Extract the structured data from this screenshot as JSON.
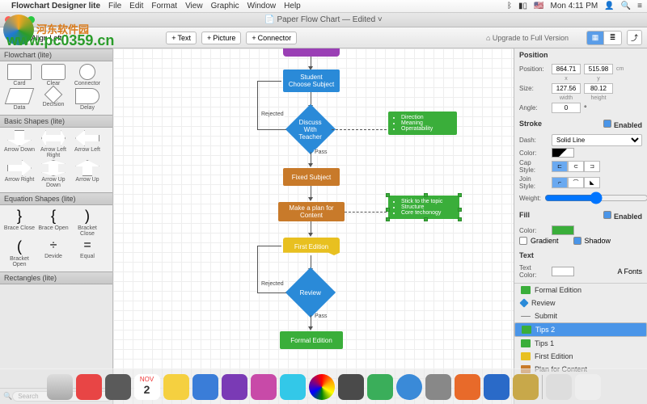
{
  "menubar": {
    "app": "Flowchart Designer lite",
    "items": [
      "File",
      "Edit",
      "Format",
      "View",
      "Graphic",
      "Window",
      "Help"
    ],
    "battery": "",
    "time": "Mon 4:11 PM"
  },
  "window": {
    "title": "Paper Flow Chart — Edited"
  },
  "toolbar": {
    "align": "Align Left",
    "btns": [
      {
        "plus": "+",
        "label": "Text"
      },
      {
        "plus": "+",
        "label": "Picture"
      },
      {
        "plus": "+",
        "label": "Connector"
      }
    ],
    "upgrade": "Upgrade to Full Version"
  },
  "sidebar": {
    "sections": [
      {
        "title": "Flowchart (lite)",
        "shapes": [
          {
            "label": "Card"
          },
          {
            "label": "Clear"
          },
          {
            "label": "Connector"
          },
          {
            "label": "Data"
          },
          {
            "label": "Decision"
          },
          {
            "label": "Delay"
          }
        ]
      },
      {
        "title": "Basic Shapes (lite)",
        "shapes": [
          {
            "label": "Arrow Down"
          },
          {
            "label": "Arrow Left Right"
          },
          {
            "label": "Arrow Left"
          },
          {
            "label": "Arrow Right"
          },
          {
            "label": "Arrow Up Down"
          },
          {
            "label": "Arrow Up"
          }
        ]
      },
      {
        "title": "Equation Shapes (lite)",
        "shapes": [
          {
            "label": "Brace Close"
          },
          {
            "label": "Brace Open"
          },
          {
            "label": "Bracket Close"
          },
          {
            "label": "Bracket Open"
          },
          {
            "label": "Devide"
          },
          {
            "label": "Equal"
          }
        ]
      },
      {
        "title": "Rectangles (lite)",
        "shapes": []
      }
    ],
    "search_placeholder": "Search"
  },
  "canvas": {
    "nodes": {
      "top": "",
      "student": "Student\nChoose Subject",
      "discuss": "Discuss\nWith Teacher",
      "fixed": "Fixed Subject",
      "plan": "Make a plan for\nContent",
      "first": "First Edition",
      "review": "Review",
      "formal": "Formal Edition"
    },
    "labels": {
      "rejected": "Rejected",
      "pass": "Pass"
    },
    "notes": {
      "n1": [
        "Direction",
        "Meaning",
        "Operatability"
      ],
      "n2": [
        "Stick to the topic",
        "Structure",
        "Core techonogy"
      ]
    }
  },
  "inspector": {
    "position": {
      "title": "Position",
      "pos_label": "Position:",
      "x": "864.71",
      "y": "515.98",
      "unit": "cm",
      "x_sub": "x",
      "y_sub": "y",
      "size_label": "Size:",
      "w": "127.56",
      "h": "80.12",
      "w_sub": "width",
      "h_sub": "height",
      "angle_label": "Angle:",
      "angle": "0",
      "angle_unit": "°"
    },
    "stroke": {
      "title": "Stroke",
      "enabled": "Enabled",
      "dash_label": "Dash:",
      "dash": "Solid Line",
      "color_label": "Color:",
      "cap_label": "Cap Style:",
      "join_label": "Join Style:",
      "weight_label": "Weight:",
      "weight": "1.0"
    },
    "fill": {
      "title": "Fill",
      "enabled": "Enabled",
      "color_label": "Color:",
      "gradient": "Gradient",
      "shadow": "Shadow"
    },
    "text": {
      "title": "Text",
      "color_label": "Text Color:",
      "fonts": "Fonts"
    }
  },
  "outline": [
    {
      "label": "Formal Edition",
      "color": "#3aae3a"
    },
    {
      "label": "Review",
      "color": "#2a8ad8"
    },
    {
      "label": "Submit",
      "color": "#888"
    },
    {
      "label": "Tips 2",
      "color": "#3aae3a",
      "selected": true
    },
    {
      "label": "Tips 1",
      "color": "#3aae3a"
    },
    {
      "label": "First Edition",
      "color": "#e8c020"
    },
    {
      "label": "Plan for Content",
      "color": "#c87a2a"
    }
  ],
  "watermark": {
    "cn": "河东软件园",
    "url": "www.pc0359.cn"
  }
}
